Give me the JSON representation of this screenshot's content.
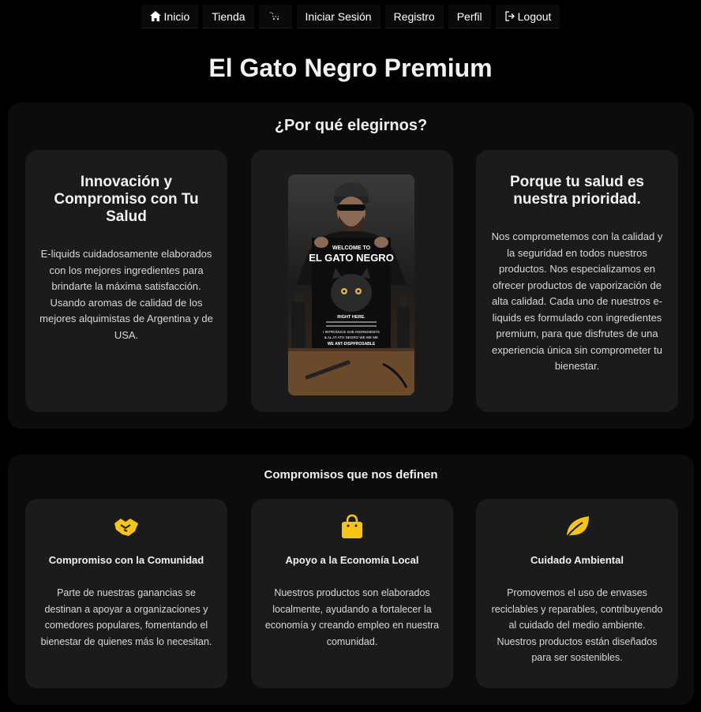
{
  "nav": {
    "items": [
      {
        "label": "Inicio",
        "icon": "home-icon"
      },
      {
        "label": "Tienda"
      },
      {
        "label": "",
        "icon": "cart-icon"
      },
      {
        "label": "Iniciar Sesión"
      },
      {
        "label": "Registro"
      },
      {
        "label": "Perfil"
      },
      {
        "label": "Logout",
        "icon": "logout-icon"
      }
    ]
  },
  "page_title": "El Gato Negro Premium",
  "why": {
    "title": "¿Por qué elegirnos?",
    "left": {
      "title": "Innovación y Compromiso con Tu Salud",
      "text": "E-liquids cuidadosamente elaborados con los mejores ingredientes para brindarte la máxima satisfacción. Usando aromas de calidad de los mejores alquimistas de Argentina y de USA."
    },
    "poster": {
      "line1": "WELCOME TO",
      "line2": "EL GATO NEGRO",
      "line3": "RIGHT HERE.",
      "line4": "I INTRODUCE SHE INGREDIENTS",
      "line5": "& AL AT ATO NEGRO WE WE ME",
      "line6": "WE ANT-DISPPROSABLE"
    },
    "right": {
      "title": "Porque tu salud es nuestra prioridad.",
      "text": "Nos comprometemos con la calidad y la seguridad en todos nuestros productos. Nos especializamos en ofrecer productos de vaporización de alta calidad. Cada uno de nuestros e-liquids es formulado con ingredientes premium, para que disfrutes de una experiencia única sin comprometer tu bienestar."
    }
  },
  "commitments": {
    "title": "Compromisos que nos definen",
    "cards": [
      {
        "icon": "handshake-icon",
        "title": "Compromiso con la Comunidad",
        "text": "Parte de nuestras ganancias se destinan a apoyar a organizaciones y comedores populares, fomentando el bienestar de quienes más lo necesitan."
      },
      {
        "icon": "shopping-bag-icon",
        "title": "Apoyo a la Economía Local",
        "text": "Nuestros productos son elaborados localmente, ayudando a fortalecer la economía y creando empleo en nuestra comunidad."
      },
      {
        "icon": "leaf-icon",
        "title": "Cuidado Ambiental",
        "text": "Promovemos el uso de envases reciclables y reparables, contribuyendo al cuidado del medio ambiente. Nuestros productos están diseñados para ser sostenibles."
      }
    ]
  },
  "colors": {
    "accent": "#f5c518",
    "background": "#000000",
    "card": "#1b1b1b",
    "section": "#0c0c0c"
  }
}
